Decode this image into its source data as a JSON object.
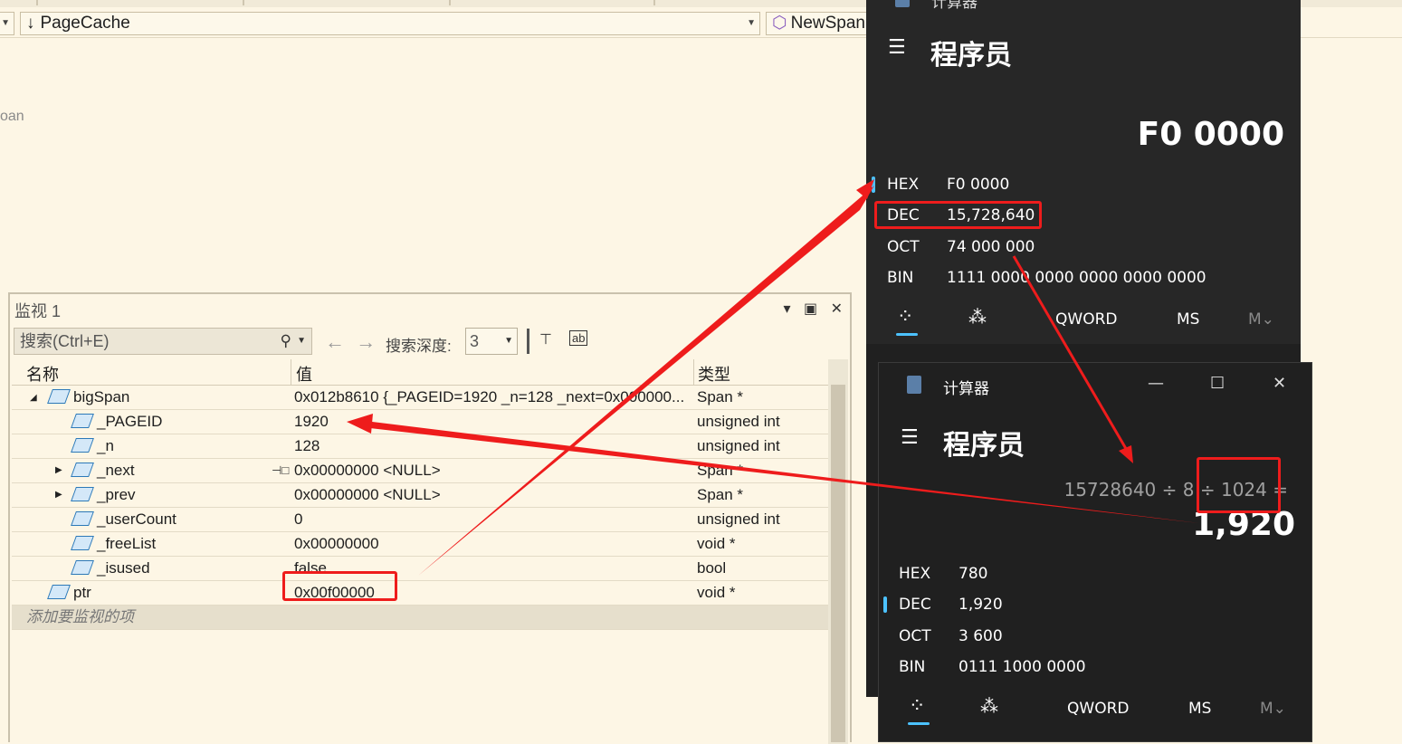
{
  "nav": {
    "page_cache": "PageCache",
    "new_span": "NewSpan"
  },
  "edge_text": "oan",
  "watch": {
    "title": "监视 1",
    "search_placeholder": "搜索(Ctrl+E)",
    "depth_label": "搜索深度:",
    "depth_value": "3",
    "columns": {
      "name": "名称",
      "value": "值",
      "type": "类型"
    },
    "rows": [
      {
        "name": "bigSpan",
        "value": "0x012b8610 {_PAGEID=1920 _n=128 _next=0x000000...",
        "type": "Span *"
      },
      {
        "name": "_PAGEID",
        "value": "1920",
        "type": "unsigned int"
      },
      {
        "name": "_n",
        "value": "128",
        "type": "unsigned int"
      },
      {
        "name": "_next",
        "value": "0x00000000 <NULL>",
        "type": "Span *"
      },
      {
        "name": "_prev",
        "value": "0x00000000 <NULL>",
        "type": "Span *"
      },
      {
        "name": "_userCount",
        "value": "0",
        "type": "unsigned int"
      },
      {
        "name": "_freeList",
        "value": "0x00000000",
        "type": "void *"
      },
      {
        "name": "_isused",
        "value": "false",
        "type": "bool"
      },
      {
        "name": "ptr",
        "value": "0x00f00000",
        "type": "void *"
      }
    ],
    "add_item": "添加要监视的项"
  },
  "calc1": {
    "title": "计算器",
    "mode": "程序员",
    "display": "F0 0000",
    "hex_label": "HEX",
    "hex": "F0 0000",
    "dec_label": "DEC",
    "dec": "15,728,640",
    "oct_label": "OCT",
    "oct": "74 000 000",
    "bin_label": "BIN",
    "bin": "1111 0000 0000 0000 0000 0000",
    "word": "QWORD",
    "ms": "MS",
    "m": "M"
  },
  "calc2": {
    "title": "计算器",
    "mode": "程序员",
    "expression_a": "15728640 ÷",
    "expression_b": "8 ÷ 1024",
    "expression_eq": "=",
    "display": "1,920",
    "hex_label": "HEX",
    "hex": "780",
    "dec_label": "DEC",
    "dec": "1,920",
    "oct_label": "OCT",
    "oct": "3 600",
    "bin_label": "BIN",
    "bin": "0111 1000 0000",
    "word": "QWORD",
    "ms": "MS",
    "m": "M"
  },
  "colors": {
    "annotation": "#ee1c1c",
    "accent": "#4cc2ff",
    "cube": "#2c79b8"
  }
}
